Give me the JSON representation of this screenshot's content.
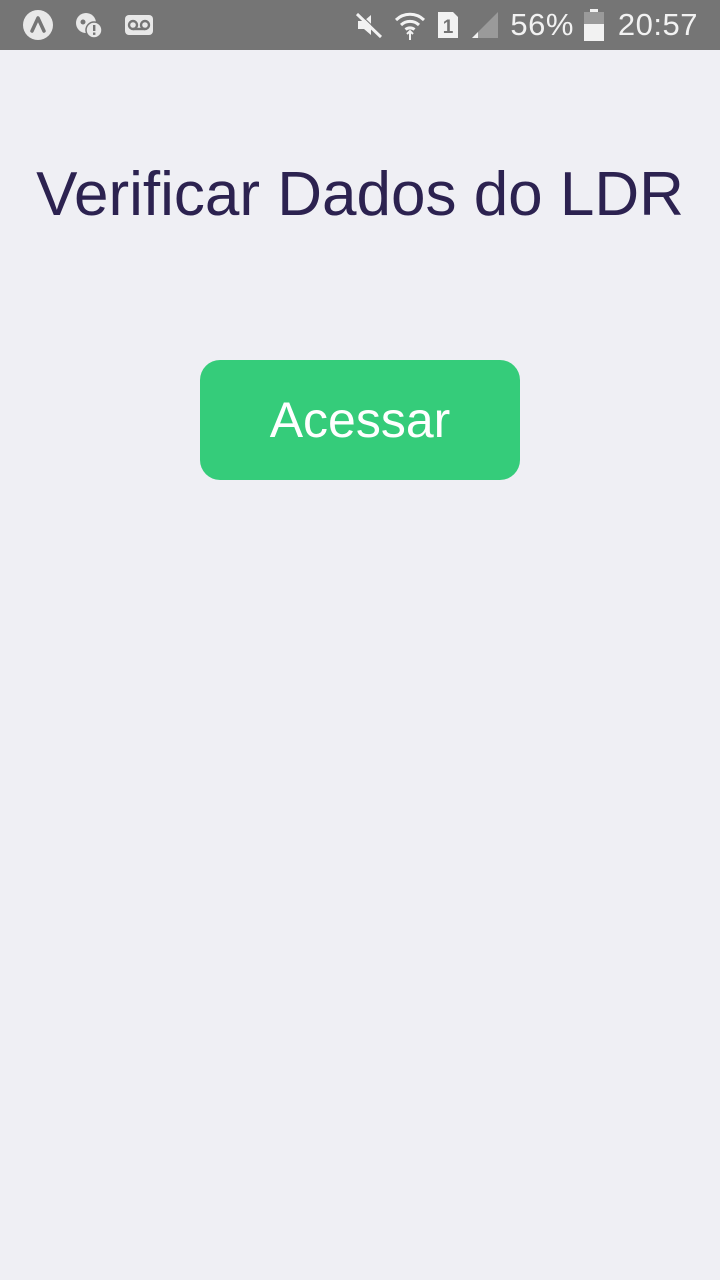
{
  "status_bar": {
    "battery_percent": "56%",
    "time": "20:57",
    "sim_slot": "1",
    "icons": {
      "left": [
        "app-notification-icon",
        "alert-notification-icon",
        "voicemail-icon"
      ],
      "right": [
        "mute-icon",
        "wifi-icon",
        "sim-icon",
        "signal-icon",
        "battery-icon"
      ]
    }
  },
  "main": {
    "title": "Verificar Dados do LDR",
    "access_button_label": "Acessar"
  },
  "colors": {
    "background": "#efeff4",
    "status_bar": "#757575",
    "title_text": "#2c2250",
    "button": "#35cc7a",
    "button_text": "#ffffff"
  }
}
